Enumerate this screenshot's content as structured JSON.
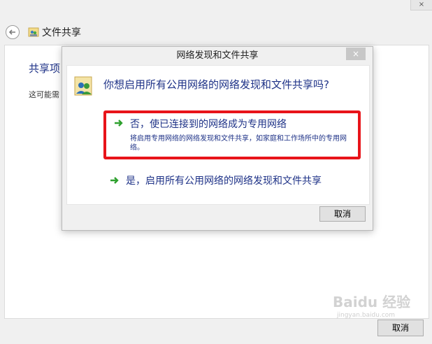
{
  "outer": {
    "title": "文件共享",
    "heading": "共享项",
    "desc": "这可能需",
    "cancel_label": "取消",
    "close_glyph": "×"
  },
  "dialog": {
    "title": "网络发现和文件共享",
    "close_glyph": "×",
    "question": "你想启用所有公用网络的网络发现和文件共享吗?",
    "option_private": {
      "title": "否，使已连接到的网络成为专用网络",
      "desc": "将启用专用网络的网络发现和文件共享，如家庭和工作场所中的专用网络。"
    },
    "option_public": {
      "title": "是，启用所有公用网络的网络发现和文件共享"
    },
    "cancel_label": "取消"
  },
  "watermark": {
    "main": "Baidu 经验",
    "sub": "jingyan.baidu.com"
  },
  "colors": {
    "link_blue": "#1e3287",
    "highlight_red": "#e8141a",
    "arrow_green": "#2ea02e"
  }
}
